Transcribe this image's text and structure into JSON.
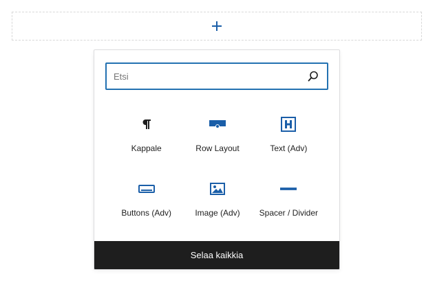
{
  "search": {
    "placeholder": "Etsi",
    "value": "",
    "icon": "search-icon"
  },
  "blocks": [
    {
      "label": "Kappale",
      "icon": "paragraph-icon"
    },
    {
      "label": "Row Layout",
      "icon": "row-layout-icon"
    },
    {
      "label": "Text (Adv)",
      "icon": "heading-icon"
    },
    {
      "label": "Buttons (Adv)",
      "icon": "buttons-icon"
    },
    {
      "label": "Image (Adv)",
      "icon": "image-icon"
    },
    {
      "label": "Spacer / Divider",
      "icon": "spacer-divider-icon"
    }
  ],
  "footer": {
    "browse_all_label": "Selaa kaikkia"
  },
  "colors": {
    "accent": "#2271b1",
    "footer_bg": "#1e1e1e",
    "icon_blue": "#1a5ea8"
  }
}
